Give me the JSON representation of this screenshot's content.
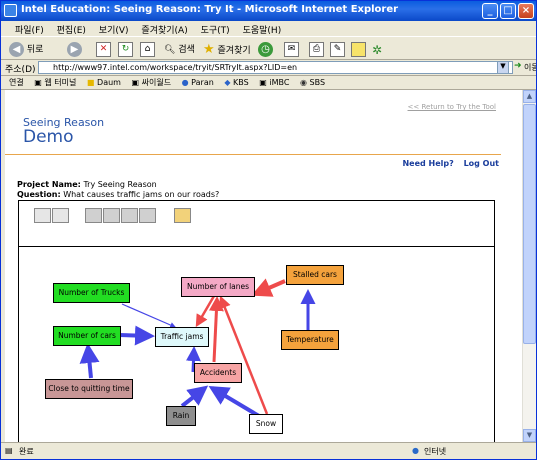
{
  "window": {
    "title": "Intel Education: Seeing Reason: Try It - Microsoft Internet Explorer"
  },
  "menu": [
    "파일(F)",
    "편집(E)",
    "보기(V)",
    "즐겨찾기(A)",
    "도구(T)",
    "도움말(H)"
  ],
  "toolbar": {
    "back_label": "뒤로",
    "search_label": "검색",
    "favorites_label": "즐겨찾기"
  },
  "address": {
    "label": "주소(D)",
    "url": "http://www97.intel.com/workspace/tryit/SRTryIt.aspx?LID=en",
    "go_label": "이동"
  },
  "links": {
    "label": "연결",
    "items": [
      "웹 터미널",
      "Daum",
      "싸이월드",
      "Paran",
      "KBS",
      "iMBC",
      "SBS"
    ]
  },
  "page": {
    "return_link": "<< Return to Try the Tool",
    "brand_line1": "Seeing Reason",
    "brand_line2": "Demo",
    "help_link": "Need Help?",
    "logout_link": "Log Out",
    "project_label": "Project Name:",
    "project_name": "Try Seeing Reason",
    "question_label": "Question:",
    "question_text": "What causes traffic jams on our roads?"
  },
  "map": {
    "nodes": [
      {
        "id": "number_of_trucks",
        "label": "Number of Trucks",
        "color": "#22dd22"
      },
      {
        "id": "number_of_lanes",
        "label": "Number of lanes",
        "color": "#f4a9c6"
      },
      {
        "id": "stalled_cars",
        "label": "Stalled cars",
        "color": "#f4a23c"
      },
      {
        "id": "number_of_cars",
        "label": "Number of cars",
        "color": "#22dd22"
      },
      {
        "id": "traffic_jams",
        "label": "Traffic jams",
        "color": "#dff9fb"
      },
      {
        "id": "temperature",
        "label": "Temperature",
        "color": "#f4a23c"
      },
      {
        "id": "accidents",
        "label": "Accidents",
        "color": "#f7a4a4"
      },
      {
        "id": "close_to_quitting_time",
        "label": "Close to quitting time",
        "color": "#c89696"
      },
      {
        "id": "rain",
        "label": "Rain",
        "color": "#8f8f8f"
      },
      {
        "id": "snow",
        "label": "Snow",
        "color": "#ffffff"
      }
    ],
    "link_colors": {
      "increase": "#4646e6",
      "decrease": "#ee4b4b"
    }
  },
  "status": {
    "left": "완료",
    "zone": "인터넷"
  }
}
